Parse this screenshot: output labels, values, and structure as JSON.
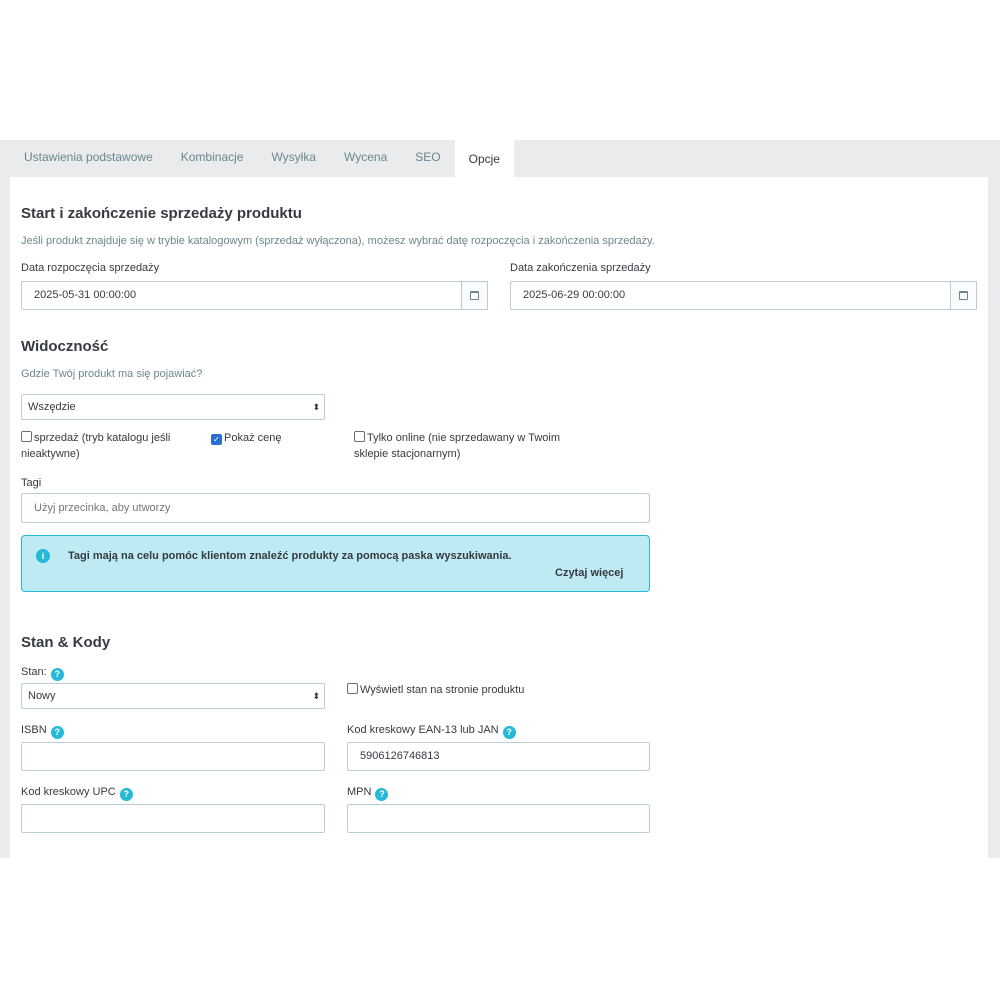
{
  "tabs": [
    {
      "label": "Ustawienia podstawowe"
    },
    {
      "label": "Kombinacje"
    },
    {
      "label": "Wysyłka"
    },
    {
      "label": "Wycena"
    },
    {
      "label": "SEO"
    },
    {
      "label": "Opcje"
    }
  ],
  "active_tab": "Opcje",
  "sale": {
    "title": "Start i zakończenie sprzedaży produktu",
    "help": "Jeśli produkt znajduje się w trybie katalogowym (sprzedaż wyłączona), możesz wybrać datę rozpoczęcia i zakończenia sprzedaży.",
    "start_label": "Data rozpoczęcia sprzedaży",
    "start_value": "2025-05-31 00:00:00",
    "end_label": "Data zakończenia sprzedaży",
    "end_value": "2025-06-29 00:00:00"
  },
  "visibility": {
    "title": "Widoczność",
    "help": "Gdzie Twój produkt ma się pojawiać?",
    "select_value": "Wszędzie",
    "checkbox_sale_label": "sprzedaż (tryb katalogu jeśli nieaktywne)",
    "checkbox_sale_checked": false,
    "checkbox_price_label": "Pokaż cenę",
    "checkbox_price_checked": true,
    "checkbox_online_label": "Tylko online (nie sprzedawany w Twoim sklepie stacjonarnym)",
    "checkbox_online_checked": false
  },
  "tags": {
    "label": "Tagi",
    "placeholder": "Użyj przecinka, aby utworzy",
    "alert_text": "Tagi mają na celu pomóc klientom znaleźć produkty za pomocą paska wyszukiwania.",
    "alert_link": "Czytaj więcej"
  },
  "codes": {
    "title": "Stan & Kody",
    "condition_label": "Stan:",
    "condition_value": "Nowy",
    "show_condition_label": "Wyświetl stan na stronie produktu",
    "show_condition_checked": false,
    "isbn_label": "ISBN",
    "isbn_value": "",
    "ean_label": "Kod kreskowy EAN-13 lub JAN",
    "ean_value": "5906126746813",
    "upc_label": "Kod kreskowy UPC",
    "upc_value": "",
    "mpn_label": "MPN",
    "mpn_value": ""
  },
  "colors": {
    "accent": "#25b9d7",
    "alert_bg": "#bdeaf3",
    "checkbox_on": "#2a6fd1"
  }
}
